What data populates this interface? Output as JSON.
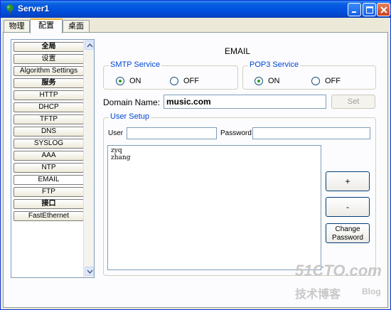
{
  "window": {
    "title": "Server1"
  },
  "tabs": [
    {
      "label": "物理"
    },
    {
      "label": "配置"
    },
    {
      "label": "桌面"
    }
  ],
  "sidebar": {
    "items": [
      {
        "label": "全局",
        "kind": "header"
      },
      {
        "label": "设置",
        "kind": "item"
      },
      {
        "label": "Algorithm Settings",
        "kind": "item"
      },
      {
        "label": "服务",
        "kind": "header"
      },
      {
        "label": "HTTP",
        "kind": "item"
      },
      {
        "label": "DHCP",
        "kind": "item"
      },
      {
        "label": "TFTP",
        "kind": "item"
      },
      {
        "label": "DNS",
        "kind": "item"
      },
      {
        "label": "SYSLOG",
        "kind": "item"
      },
      {
        "label": "AAA",
        "kind": "item"
      },
      {
        "label": "NTP",
        "kind": "item"
      },
      {
        "label": "EMAIL",
        "kind": "item",
        "selected": true
      },
      {
        "label": "FTP",
        "kind": "item"
      },
      {
        "label": "接口",
        "kind": "header"
      },
      {
        "label": "FastEthernet",
        "kind": "item"
      }
    ]
  },
  "main": {
    "heading": "EMAIL",
    "smtp": {
      "title": "SMTP Service",
      "on_label": "ON",
      "off_label": "OFF",
      "selected": "ON"
    },
    "pop3": {
      "title": "POP3 Service",
      "on_label": "ON",
      "off_label": "OFF",
      "selected": "ON"
    },
    "domain": {
      "label": "Domain Name:",
      "value": "music.com",
      "set_label": "Set"
    },
    "user_setup": {
      "title": "User Setup",
      "user_label": "User",
      "user_value": "",
      "password_label": "Password",
      "password_value": "",
      "users": [
        "zyq",
        "zhang"
      ],
      "add_label": "+",
      "remove_label": "-",
      "change_password_line1": "Change",
      "change_password_line2": "Password"
    }
  },
  "watermark": {
    "line1": "51CTO.com",
    "line2": "技术博客",
    "line3": "Blog"
  },
  "colors": {
    "titlebar": "#0053e1",
    "group_label": "#0046d5",
    "tab_highlight": "#f1b02c",
    "radio_dot": "#21a121"
  }
}
